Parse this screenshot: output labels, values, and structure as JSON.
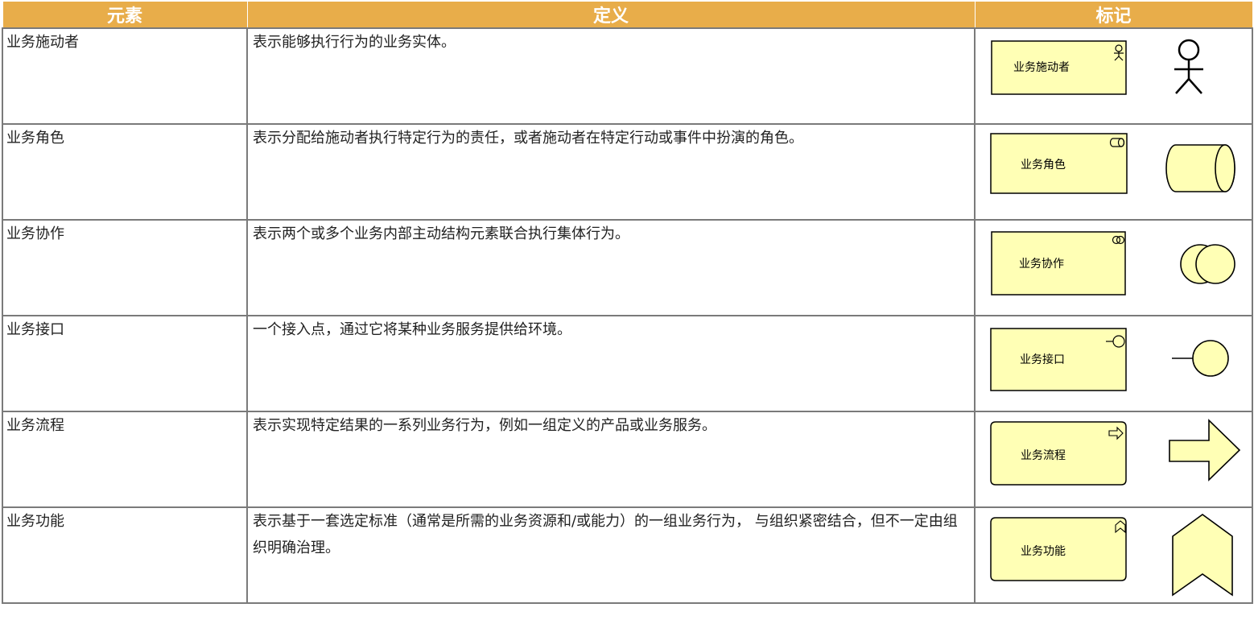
{
  "headers": {
    "element": "元素",
    "definition": "定义",
    "notation": "标记"
  },
  "rows": [
    {
      "name": "业务施动者",
      "definition": "表示能够执行行为的业务实体。",
      "box_label": "业务施动者",
      "icon": "actor-icon"
    },
    {
      "name": "业务角色",
      "definition": "表示分配给施动者执行特定行为的责任，或者施动者在特定行动或事件中扮演的角色。",
      "box_label": "业务角色",
      "icon": "role-icon"
    },
    {
      "name": "业务协作",
      "definition": "表示两个或多个业务内部主动结构元素联合执行集体行为。",
      "box_label": "业务协作",
      "icon": "collaboration-icon"
    },
    {
      "name": "业务接口",
      "definition": "一个接入点，通过它将某种业务服务提供给环境。",
      "box_label": "业务接口",
      "icon": "interface-icon"
    },
    {
      "name": "业务流程",
      "definition": "表示实现特定结果的一系列业务行为，例如一组定义的产品或业务服务。",
      "box_label": "业务流程",
      "icon": "process-icon"
    },
    {
      "name": "业务功能",
      "definition": "表示基于一套选定标准（通常是所需的业务资源和/或能力）的一组业务行为， 与组织紧密结合，但不一定由组织明确治理。",
      "box_label": "业务功能",
      "icon": "function-icon"
    }
  ],
  "colors": {
    "header_bg": "#e8ad4a",
    "header_text": "#ffffff",
    "notation_fill": "#ffffb5",
    "border": "#7a7a7a"
  }
}
